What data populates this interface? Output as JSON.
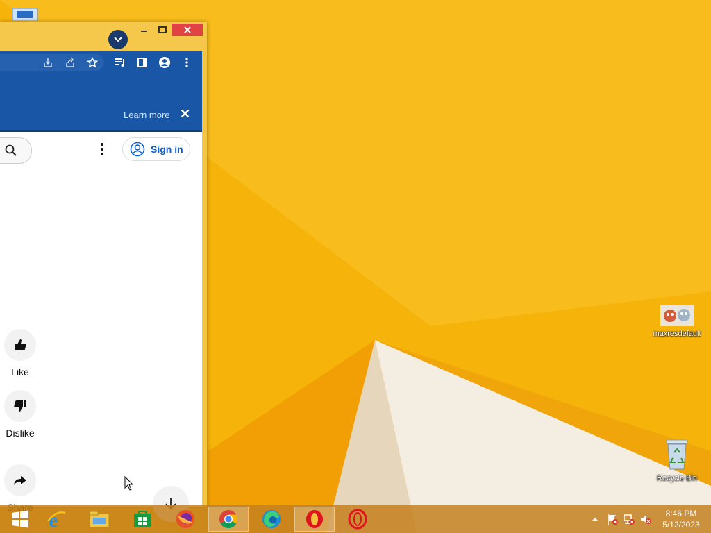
{
  "desktop": {
    "icons": [
      {
        "label": "maxresdefault"
      },
      {
        "label": "Recycle Bin"
      }
    ]
  },
  "browser": {
    "notice": {
      "learn_more": "Learn more",
      "close": "✕"
    },
    "header": {
      "sign_in": "Sign in"
    },
    "actions": [
      {
        "label": "Like"
      },
      {
        "label": "Dislike"
      },
      {
        "label": "Share"
      }
    ]
  },
  "taskbar": {
    "apps": [
      {
        "name": "start-icon"
      },
      {
        "name": "internet-explorer-icon"
      },
      {
        "name": "file-explorer-icon"
      },
      {
        "name": "store-icon"
      },
      {
        "name": "firefox-icon"
      },
      {
        "name": "chrome-icon",
        "active": true
      },
      {
        "name": "edge-icon"
      },
      {
        "name": "opera-icon",
        "active": true
      },
      {
        "name": "opera-gx-icon"
      }
    ],
    "clock": {
      "time": "8:46 PM",
      "date": "5/12/2023"
    }
  },
  "colors": {
    "accent": "#1a56a6",
    "wallpaper": "#f4b400",
    "link": "#065fd4"
  }
}
